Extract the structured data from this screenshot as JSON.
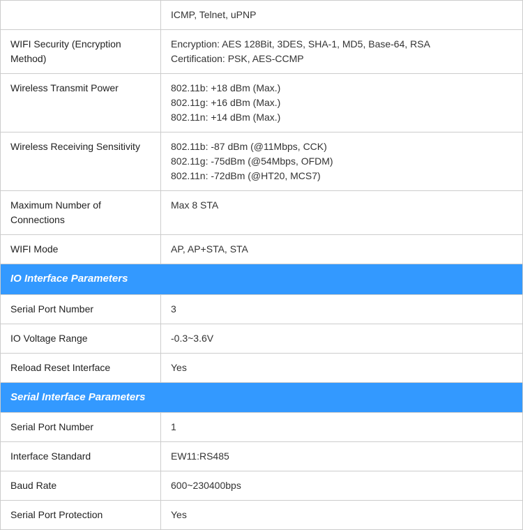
{
  "table": {
    "rows": [
      {
        "type": "data",
        "label": "",
        "value": "ICMP, Telnet, uPNP"
      },
      {
        "type": "data",
        "label": "WIFI Security (Encryption Method)",
        "value": "Encryption: AES 128Bit, 3DES, SHA-1, MD5, Base-64, RSA\nCertification: PSK, AES-CCMP"
      },
      {
        "type": "data",
        "label": "Wireless Transmit Power",
        "value": "802.11b: +18 dBm (Max.)\n802.11g: +16 dBm (Max.)\n802.11n: +14 dBm (Max.)"
      },
      {
        "type": "data",
        "label": "Wireless Receiving Sensitivity",
        "value": "802.11b: -87 dBm (@11Mbps, CCK)\n802.11g: -75dBm (@54Mbps, OFDM)\n802.11n: -72dBm (@HT20, MCS7)"
      },
      {
        "type": "data",
        "label": "Maximum Number of Connections",
        "value": "Max 8 STA"
      },
      {
        "type": "data",
        "label": "WIFI Mode",
        "value": "AP, AP+STA, STA"
      },
      {
        "type": "section",
        "label": "IO Interface Parameters"
      },
      {
        "type": "data",
        "label": "Serial Port Number",
        "value": "3"
      },
      {
        "type": "data",
        "label": "IO Voltage Range",
        "value": "-0.3~3.6V"
      },
      {
        "type": "data",
        "label": "Reload Reset Interface",
        "value": "Yes"
      },
      {
        "type": "section",
        "label": "Serial Interface Parameters"
      },
      {
        "type": "data",
        "label": "Serial Port Number",
        "value": "1"
      },
      {
        "type": "data",
        "label": "Interface Standard",
        "value": "EW11:RS485"
      },
      {
        "type": "data",
        "label": "Baud Rate",
        "value": "600~230400bps"
      },
      {
        "type": "data",
        "label": "Serial Port Protection",
        "value": "Yes"
      }
    ]
  }
}
